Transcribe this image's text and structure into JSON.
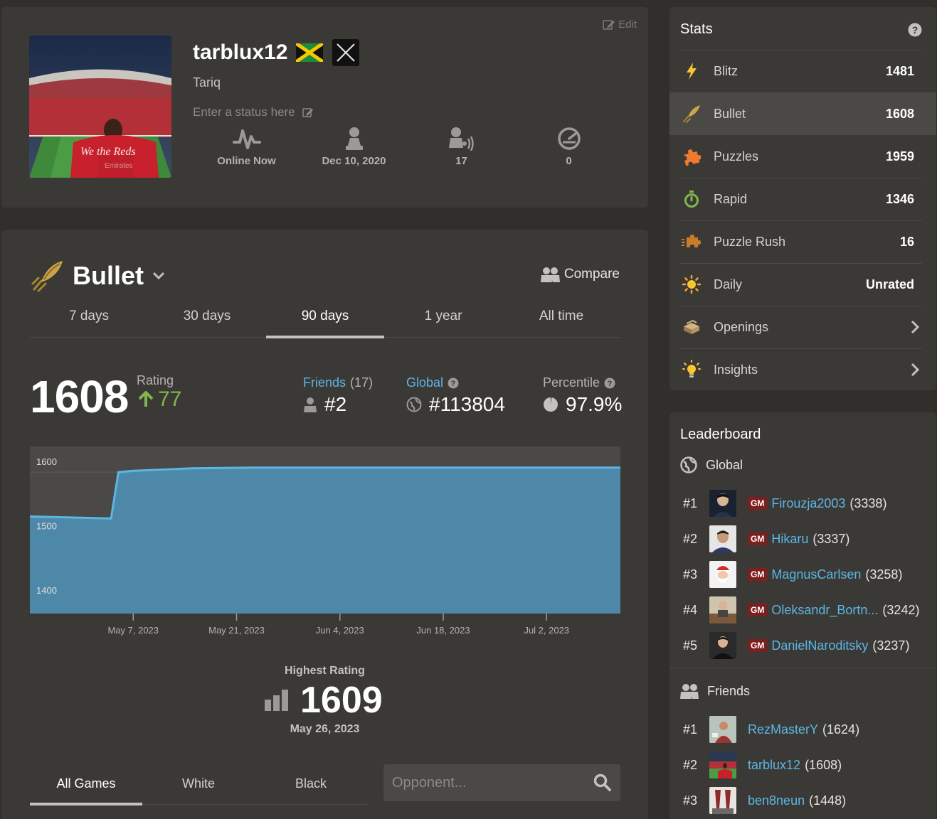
{
  "profile": {
    "edit_label": "Edit",
    "username": "tarblux12",
    "real_name": "Tariq",
    "status_placeholder": "Enter a status here",
    "stats": [
      {
        "icon": "pulse-icon",
        "value": "Online Now"
      },
      {
        "icon": "pawn-icon",
        "value": "Dec 10, 2020"
      },
      {
        "icon": "friends-sound-icon",
        "value": "17"
      },
      {
        "icon": "gauge-icon",
        "value": "0"
      }
    ]
  },
  "main": {
    "mode": "Bullet",
    "compare_label": "Compare",
    "range_tabs": [
      "7 days",
      "30 days",
      "90 days",
      "1 year",
      "All time"
    ],
    "active_range": "90 days",
    "rating": "1608",
    "rating_label": "Rating",
    "rating_change": "77",
    "friends_label": "Friends",
    "friends_count": "(17)",
    "friends_rank": "#2",
    "global_label": "Global",
    "global_rank": "#113804",
    "percentile_label": "Percentile",
    "percentile_value": "97.9%",
    "highest_label": "Highest Rating",
    "highest_value": "1609",
    "highest_date": "May 26, 2023",
    "color_tabs": [
      "All Games",
      "White",
      "Black"
    ],
    "opponent_placeholder": "Opponent..."
  },
  "chart_data": {
    "type": "area",
    "ylim": [
      1380,
      1640
    ],
    "yticks": [
      1400,
      1500,
      1600
    ],
    "ytick_labels": [
      "1600",
      "1500",
      "1400"
    ],
    "xticks": [
      "May 7, 2023",
      "May 21, 2023",
      "Jun 4, 2023",
      "Jun 18, 2023",
      "Jul 2, 2023"
    ],
    "xtick_days": [
      14,
      28,
      42,
      56,
      70
    ],
    "xlim_days": [
      0,
      80
    ],
    "points": [
      [
        0,
        1531
      ],
      [
        7,
        1529
      ],
      [
        11,
        1528
      ],
      [
        12,
        1600
      ],
      [
        14,
        1602
      ],
      [
        18,
        1604
      ],
      [
        22,
        1606
      ],
      [
        30,
        1607
      ],
      [
        50,
        1607
      ],
      [
        80,
        1607
      ]
    ],
    "fill_color": "#4f8fb3",
    "line_color": "#5bb6e6"
  },
  "stats": {
    "title": "Stats",
    "rows": [
      {
        "icon": "blitz-icon",
        "name": "Blitz",
        "value": "1481"
      },
      {
        "icon": "bullet-icon",
        "name": "Bullet",
        "value": "1608"
      },
      {
        "icon": "puzzle-icon",
        "name": "Puzzles",
        "value": "1959"
      },
      {
        "icon": "rapid-icon",
        "name": "Rapid",
        "value": "1346"
      },
      {
        "icon": "puzzle-rush-icon",
        "name": "Puzzle Rush",
        "value": "16"
      },
      {
        "icon": "daily-icon",
        "name": "Daily",
        "value": "Unrated"
      },
      {
        "icon": "openings-icon",
        "name": "Openings",
        "value": ""
      },
      {
        "icon": "insights-icon",
        "name": "Insights",
        "value": ""
      }
    ]
  },
  "leaderboard": {
    "title": "Leaderboard",
    "global_label": "Global",
    "global": [
      {
        "rank": "#1",
        "title": "GM",
        "name": "Firouzja2003",
        "score": "(3338)"
      },
      {
        "rank": "#2",
        "title": "GM",
        "name": "Hikaru",
        "score": "(3337)"
      },
      {
        "rank": "#3",
        "title": "GM",
        "name": "MagnusCarlsen",
        "score": "(3258)"
      },
      {
        "rank": "#4",
        "title": "GM",
        "name": "Oleksandr_Bortn...",
        "score": "(3242)"
      },
      {
        "rank": "#5",
        "title": "GM",
        "name": "DanielNaroditsky",
        "score": "(3237)"
      }
    ],
    "friends_label": "Friends",
    "friends": [
      {
        "rank": "#1",
        "name": "RezMasterY",
        "score": "(1624)"
      },
      {
        "rank": "#2",
        "name": "tarblux12",
        "score": "(1608)"
      },
      {
        "rank": "#3",
        "name": "ben8neun",
        "score": "(1448)"
      }
    ]
  }
}
